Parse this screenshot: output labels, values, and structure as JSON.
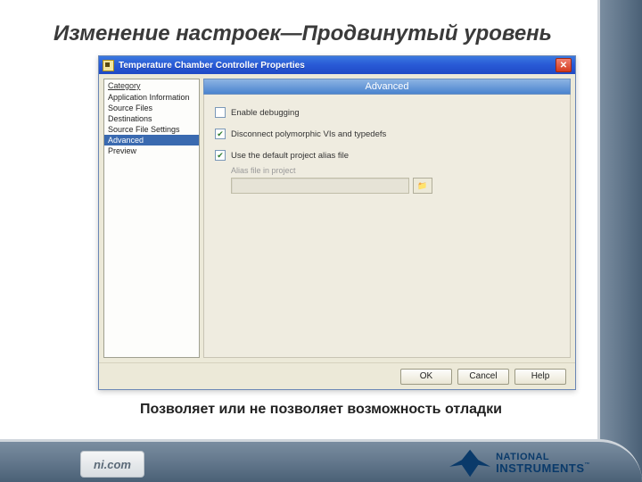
{
  "slide": {
    "title": "Изменение настроек—Продвинутый уровень",
    "caption": "Позволяет или не позволяет возможность отладки"
  },
  "branding": {
    "badge": "ni.com",
    "logo_line1": "NATIONAL",
    "logo_line2": "INSTRUMENTS",
    "tm": "™"
  },
  "dialog": {
    "title": "Temperature Chamber Controller Properties",
    "close_glyph": "✕",
    "category_header": "Category",
    "categories": [
      "Application Information",
      "Source Files",
      "Destinations",
      "Source File Settings",
      "Advanced",
      "Preview"
    ],
    "selected_category_index": 4,
    "panel_title": "Advanced",
    "checkboxes": [
      {
        "label": "Enable debugging",
        "checked": false
      },
      {
        "label": "Disconnect polymorphic VIs and typedefs",
        "checked": true
      },
      {
        "label": "Use the default project alias file",
        "checked": true
      }
    ],
    "alias": {
      "label": "Alias file in project",
      "value": "",
      "browse_glyph": "📁"
    },
    "buttons": {
      "ok": "OK",
      "cancel": "Cancel",
      "help": "Help"
    }
  }
}
